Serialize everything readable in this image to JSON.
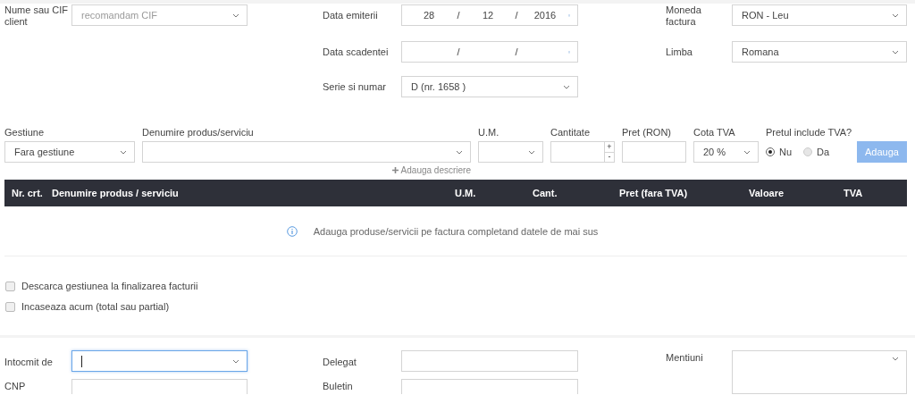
{
  "client": {
    "label": "Nume sau CIF client",
    "placeholder": "recomandam CIF"
  },
  "issue_date": {
    "label": "Data emiterii",
    "day": "28",
    "month": "12",
    "year": "2016",
    "separators": [
      "/",
      "/"
    ]
  },
  "currency": {
    "label": "Moneda factura",
    "value": "RON - Leu"
  },
  "due_date": {
    "label": "Data scadentei",
    "separators": [
      "/",
      "/"
    ]
  },
  "language": {
    "label": "Limba",
    "value": "Romana"
  },
  "series": {
    "label": "Serie si numar",
    "value": "D (nr. 1658 )"
  },
  "product_form": {
    "stock": {
      "label": "Gestiune",
      "value": "Fara gestiune"
    },
    "product": {
      "label": "Denumire produs/serviciu"
    },
    "unit": {
      "label": "U.M."
    },
    "quantity": {
      "label": "Cantitate",
      "increment": "+",
      "decrement": "-"
    },
    "price": {
      "label": "Pret (RON)"
    },
    "vat_rate": {
      "label": "Cota TVA",
      "value": "20 %"
    },
    "vat_included": {
      "label": "Pretul include TVA?",
      "options": [
        {
          "label": "Nu",
          "selected": true
        },
        {
          "label": "Da",
          "selected": false
        }
      ]
    },
    "add_button": {
      "label": "Adauga",
      "disabled": true
    },
    "add_description": "Adauga descriere"
  },
  "table": {
    "columns": [
      "Nr. crt.",
      "Denumire produs / serviciu",
      "U.M.",
      "Cant.",
      "Pret (fara TVA)",
      "Valoare",
      "TVA"
    ],
    "empty_message": "Adauga produse/servicii pe factura completand datele de mai sus"
  },
  "options": [
    {
      "label": "Descarca gestiunea la finalizarea facturii",
      "checked": false
    },
    {
      "label": "Incaseaza acum (total sau partial)",
      "checked": false
    }
  ],
  "footer": {
    "prepared_by": {
      "label": "Intocmit de",
      "focused": true
    },
    "delegate": {
      "label": "Delegat"
    },
    "notes": {
      "label": "Mentiuni"
    },
    "id_number": {
      "label": "CNP"
    },
    "id_card": {
      "label": "Buletin"
    }
  }
}
